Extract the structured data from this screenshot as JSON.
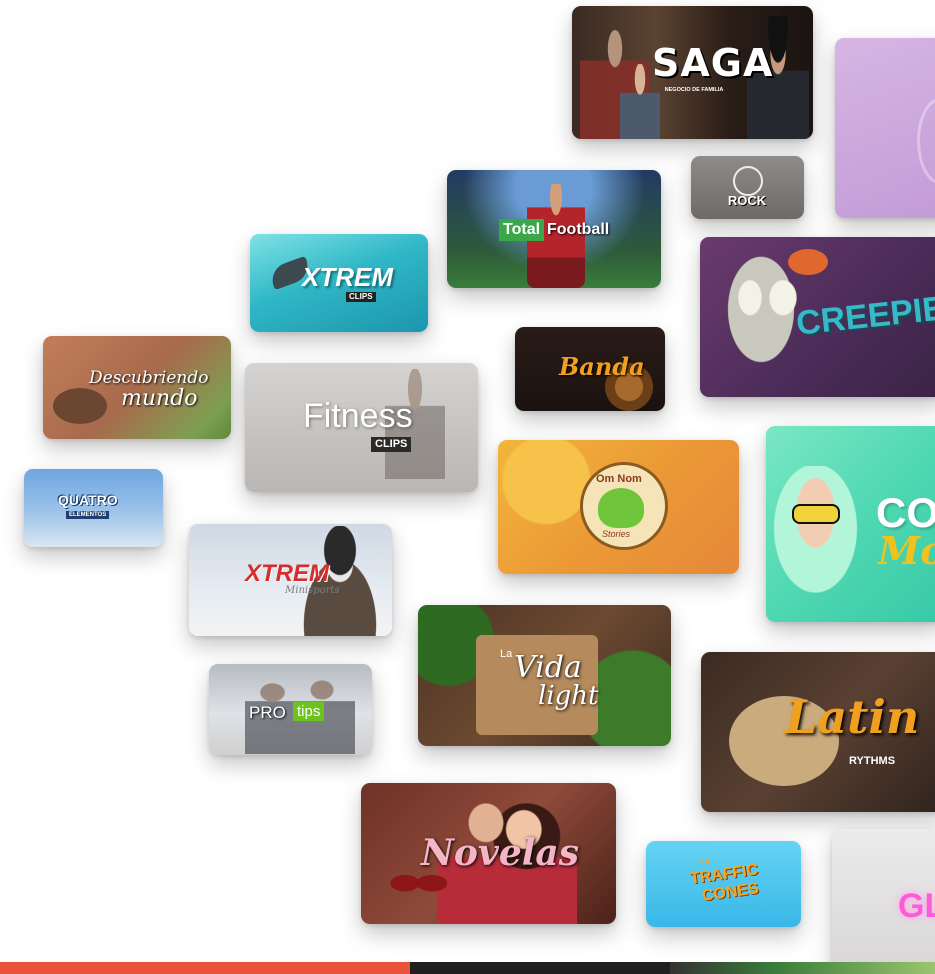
{
  "tiles": {
    "saga": {
      "title": "SAGA",
      "subtitle": "NEGOCIO DE FAMILIA"
    },
    "rock": {
      "title": "ROCK"
    },
    "total_football": {
      "word1": "Total",
      "word2": "Football"
    },
    "xtrem_clips": {
      "title": "XTREM",
      "tag": "CLIPS"
    },
    "creepie": {
      "title": "CREEPIE"
    },
    "descubriendo": {
      "line1": "Descubriendo",
      "line2": "mundo"
    },
    "banda": {
      "title": "Banda"
    },
    "fitness": {
      "title": "Fitness",
      "tag": "CLIPS"
    },
    "cuatro": {
      "title": "QUATRO",
      "tag": "ELEMENTOS"
    },
    "om_nom": {
      "title": "Om Nom",
      "tag": "Stories"
    },
    "co_mo": {
      "line1": "CO",
      "line2": "Mo"
    },
    "xtrem_minisports": {
      "title": "XTREM",
      "tag": "Minisports"
    },
    "pro_tips": {
      "word1": "PRO",
      "word2": "tips"
    },
    "vida_light": {
      "small": "La",
      "line1": "Vida",
      "line2": "light"
    },
    "latin": {
      "title": "Latin",
      "tag": "RYTHMS"
    },
    "novelas": {
      "title": "Novelas"
    },
    "traffic_cones": {
      "small": "THE",
      "line1": "TRAFFIC",
      "line2": "CONES"
    },
    "glam": {
      "title": "GL"
    }
  },
  "colors": {
    "accent_orange": "#f0a01e",
    "pro_tips_green": "#6cc31c",
    "total_green": "#3aa849",
    "creepie_teal": "#36b9c8",
    "bottom_strip_red": "#e8533a"
  }
}
